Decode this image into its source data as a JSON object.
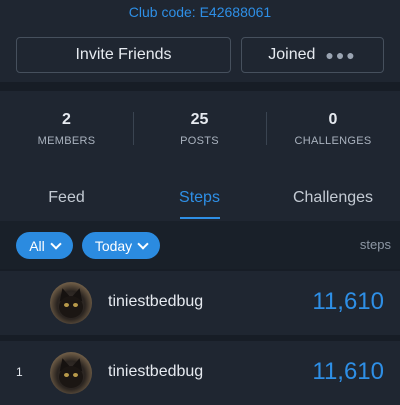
{
  "club": {
    "code_label": "Club code: E42688061"
  },
  "actions": {
    "invite_label": "Invite Friends",
    "joined_label": "Joined",
    "more_icon": "more-horizontal-icon"
  },
  "stats": [
    {
      "value": "2",
      "label": "MEMBERS"
    },
    {
      "value": "25",
      "label": "POSTS"
    },
    {
      "value": "0",
      "label": "CHALLENGES"
    }
  ],
  "tabs": [
    {
      "label": "Feed",
      "active": false
    },
    {
      "label": "Steps",
      "active": true
    },
    {
      "label": "Challenges",
      "active": false
    }
  ],
  "filters": {
    "group": "All",
    "period": "Today",
    "metric_label": "steps"
  },
  "leaderboard": [
    {
      "rank": "",
      "name": "tiniestbedbug",
      "steps": "11,610"
    },
    {
      "rank": "1",
      "name": "tiniestbedbug",
      "steps": "11,610"
    }
  ],
  "colors": {
    "accent": "#2e8fe6",
    "background": "#1f2631",
    "pill": "#2b8be0"
  }
}
